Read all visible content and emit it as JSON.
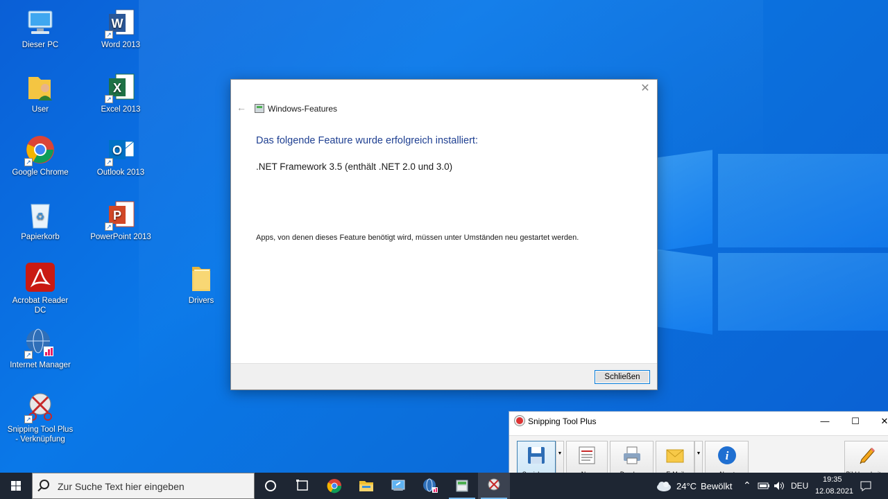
{
  "desktop": {
    "icons": [
      {
        "label": "Dieser PC",
        "icon": "computer-icon"
      },
      {
        "label": "Word 2013",
        "icon": "word-icon",
        "letter": "W"
      },
      {
        "label": "User",
        "icon": "user-folder-icon"
      },
      {
        "label": "Excel 2013",
        "icon": "excel-icon",
        "letter": "X"
      },
      {
        "label": "Google Chrome",
        "icon": "chrome-icon"
      },
      {
        "label": "Outlook 2013",
        "icon": "outlook-icon",
        "letter": "O"
      },
      {
        "label": "Papierkorb",
        "icon": "recycle-bin-icon"
      },
      {
        "label": "PowerPoint 2013",
        "icon": "powerpoint-icon",
        "letter": "P"
      },
      {
        "label": "Acrobat Reader DC",
        "icon": "acrobat-icon"
      },
      {
        "label": "Drivers",
        "icon": "folder-icon"
      },
      {
        "label": "Internet Manager",
        "icon": "internet-manager-icon"
      },
      {
        "label": "Snipping Tool Plus - Verknüpfung",
        "icon": "snipping-tool-icon"
      }
    ]
  },
  "dialog": {
    "title": "Windows-Features",
    "heading": "Das folgende Feature wurde erfolgreich installiert:",
    "feature": ".NET Framework 3.5 (enthält .NET 2.0 und 3.0)",
    "note": "Apps, von denen dieses Feature benötigt wird, müssen unter Umständen neu gestartet werden.",
    "close_button": "Schließen"
  },
  "snipping_tool": {
    "title": "Snipping Tool Plus",
    "buttons": {
      "save": "Speichern",
      "new": "Neu",
      "print": "Drucken",
      "email": "E-Mail",
      "about": "About",
      "edit_image": "Bild bearbeiten"
    }
  },
  "taskbar": {
    "search_placeholder": "Zur Suche Text hier eingeben",
    "weather": {
      "temp": "24°C",
      "condition": "Bewölkt"
    },
    "language": "DEU",
    "time": "19:35",
    "date": "12.08.2021"
  },
  "colors": {
    "dialog_heading": "#1e3f91",
    "taskbar_bg": "#1e2633",
    "accent": "#0078d7"
  }
}
